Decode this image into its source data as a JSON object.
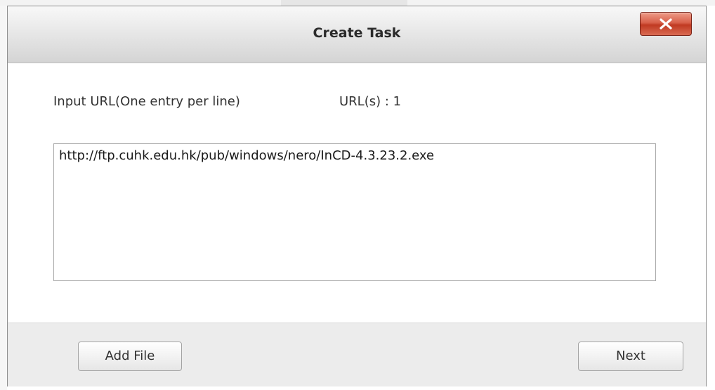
{
  "dialog": {
    "title": "Create Task",
    "close_icon": "close-x-icon"
  },
  "form": {
    "url_label": "Input URL(One entry per line)",
    "url_count": "URL(s) : 1",
    "url_value": "http://ftp.cuhk.edu.hk/pub/windows/nero/InCD-4.3.23.2.exe"
  },
  "footer": {
    "add_file_label": "Add File",
    "next_label": "Next"
  },
  "colors": {
    "close_button": "#d2523a",
    "titlebar": "#e4e4e4",
    "footer": "#ececec"
  }
}
